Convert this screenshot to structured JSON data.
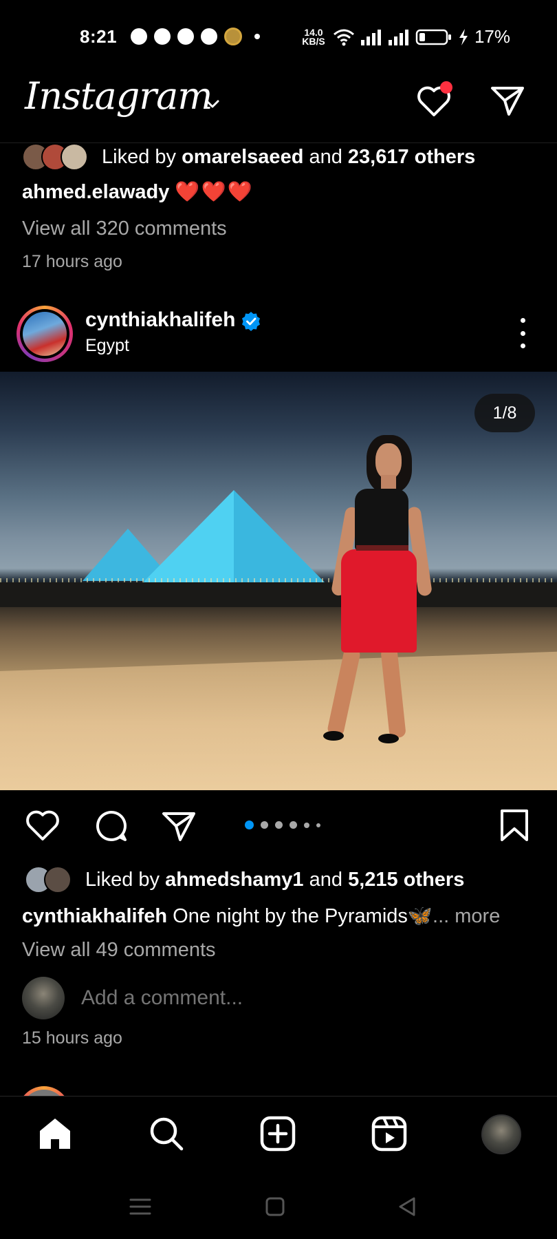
{
  "status_bar": {
    "time": "8:21",
    "net_speed_value": "14.0",
    "net_speed_unit": "KB/S",
    "battery": "17%",
    "notification_icons": [
      "chat-icon",
      "snapchat-icon",
      "messenger-icon",
      "whatsapp-icon",
      "app-icon"
    ]
  },
  "header": {
    "logo": "Instagram",
    "activity_badge_color": "#ff3040"
  },
  "prev_post": {
    "liked_prefix": "Liked by ",
    "liked_user": "omarelsaeed",
    "liked_mid": " and ",
    "liked_count": "23,617 others",
    "caption_user": "ahmed.elawady",
    "caption_emoji": "❤️❤️❤️",
    "view_comments": "View all 320 comments",
    "time": "17 hours ago"
  },
  "post": {
    "username": "cynthiakhalifeh",
    "location": "Egypt",
    "counter": "1/8",
    "carousel_total": 8,
    "carousel_active": 1,
    "liked_prefix": "Liked by ",
    "liked_user": "ahmedshamy1",
    "liked_mid": " and ",
    "liked_count": "5,215 others",
    "caption_user": "cynthiakhalifeh",
    "caption_text": " One night by the Pyramids🦋",
    "caption_more": "... more",
    "view_comments": "View all 49 comments",
    "add_comment_placeholder": "Add a comment...",
    "time": "15 hours ago",
    "accent_color": "#0095f6"
  },
  "bottom_nav": {
    "items": [
      "home-icon",
      "search-icon",
      "create-icon",
      "reels-icon",
      "profile-avatar"
    ]
  }
}
